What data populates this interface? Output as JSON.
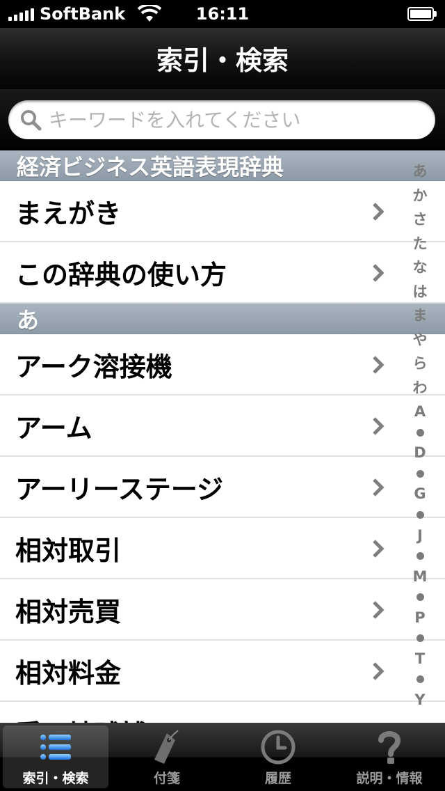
{
  "status_bar": {
    "carrier": "SoftBank",
    "time": "16:11",
    "battery_level": 1.0
  },
  "nav": {
    "title": "索引・検索"
  },
  "search": {
    "placeholder": "キーワードを入れてください",
    "value": ""
  },
  "sections": [
    {
      "title": "経済ビジネス英語表現辞典",
      "rows": [
        "まえがき",
        "この辞典の使い方"
      ]
    },
    {
      "title": "あ",
      "rows": [
        "アーク溶接機",
        "アーム",
        "アーリーステージ",
        "相対取引",
        "相対売買",
        "相対料金",
        "愛・地球博"
      ]
    }
  ],
  "section_index": [
    "あ",
    "か",
    "さ",
    "た",
    "な",
    "は",
    "ま",
    "や",
    "ら",
    "わ",
    "A",
    "•",
    "D",
    "•",
    "G",
    "•",
    "J",
    "•",
    "M",
    "•",
    "P",
    "•",
    "T",
    "•",
    "Y"
  ],
  "tabs": [
    {
      "label": "索引・検索",
      "icon": "list-icon",
      "selected": true
    },
    {
      "label": "付箋",
      "icon": "tag-icon",
      "selected": false
    },
    {
      "label": "履歴",
      "icon": "clock-icon",
      "selected": false
    },
    {
      "label": "説明・情報",
      "icon": "question-icon",
      "selected": false
    }
  ],
  "colors": {
    "section_header": "#9aa6b2",
    "selected_tab_icon": "#3d8ff0",
    "index_text": "#7b7b7b"
  }
}
